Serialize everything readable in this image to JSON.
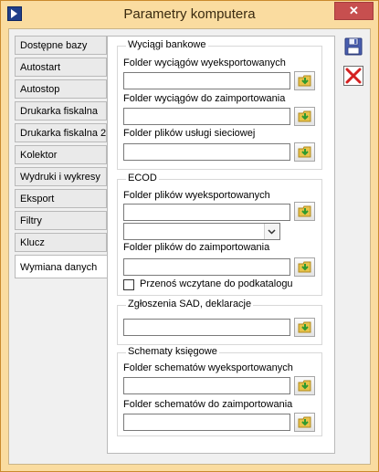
{
  "window": {
    "title": "Parametry komputera",
    "close_glyph": "✕"
  },
  "tabs": [
    {
      "label": "Dostępne bazy",
      "active": false
    },
    {
      "label": "Autostart",
      "active": false
    },
    {
      "label": "Autostop",
      "active": false
    },
    {
      "label": "Drukarka fiskalna",
      "active": false
    },
    {
      "label": "Drukarka fiskalna 2",
      "active": false
    },
    {
      "label": "Kolektor",
      "active": false
    },
    {
      "label": "Wydruki i wykresy",
      "active": false
    },
    {
      "label": "Eksport",
      "active": false
    },
    {
      "label": "Filtry",
      "active": false
    },
    {
      "label": "Klucz",
      "active": false
    },
    {
      "label": "Wymiana danych",
      "active": true
    }
  ],
  "bank": {
    "legend": "Wyciągi bankowe",
    "export_label": "Folder wyciągów wyeksportowanych",
    "export_value": "",
    "import_label": "Folder wyciągów do zaimportowania",
    "import_value": "",
    "service_label": "Folder plików usługi sieciowej",
    "service_value": ""
  },
  "ecod": {
    "legend": "ECOD",
    "export_label": "Folder plików wyeksportowanych",
    "export_value": "",
    "select_value": "",
    "import_label": "Folder plików do zaimportowania",
    "import_value": "",
    "move_checkbox_label": "Przenoś wczytane do podkatalogu",
    "move_checked": false
  },
  "sad": {
    "legend": "Zgłoszenia SAD, deklaracje",
    "value": ""
  },
  "schemes": {
    "legend": "Schematy księgowe",
    "export_label": "Folder schematów wyeksportowanych",
    "export_value": "",
    "import_label": "Folder schematów do zaimportowania",
    "import_value": ""
  },
  "icons": {
    "app": "app-icon",
    "browse": "folder-arrow-icon",
    "save": "floppy-disk-icon",
    "cancel": "red-x-icon"
  },
  "colors": {
    "frame": "#fadca0",
    "close": "#c74f4f",
    "accent_green": "#3aa53a",
    "folder": "#e8c34a"
  }
}
